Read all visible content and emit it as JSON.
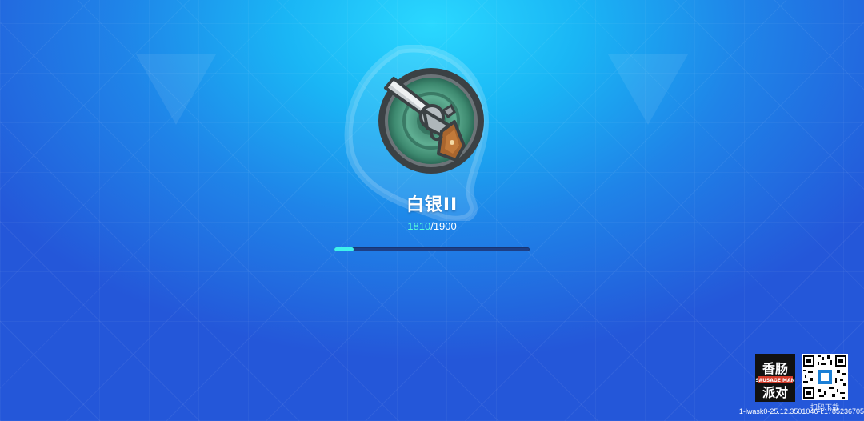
{
  "rank": {
    "name": "白银II",
    "current": "1810",
    "separator": "/",
    "target": "1900",
    "progress_fraction": 0.1
  },
  "badge": {
    "icon": "revolver-icon",
    "colors": {
      "ring_inner": "#5fae92",
      "ring_outer": "#2c6b58",
      "rim": "#3b4144"
    }
  },
  "watermark": {
    "logo_text": "香肠派对",
    "logo_subtext": "SAUSAGE MAN",
    "qr_label": "扫码下载"
  },
  "footer": {
    "build_info": "1-lwask0-25.12.3501046-l:1785236705"
  },
  "colors": {
    "bg_top": "#2ad8ff",
    "bg_bottom": "#2457d9",
    "accent": "#3ff2ec",
    "progress_track": "#1d3f86"
  }
}
